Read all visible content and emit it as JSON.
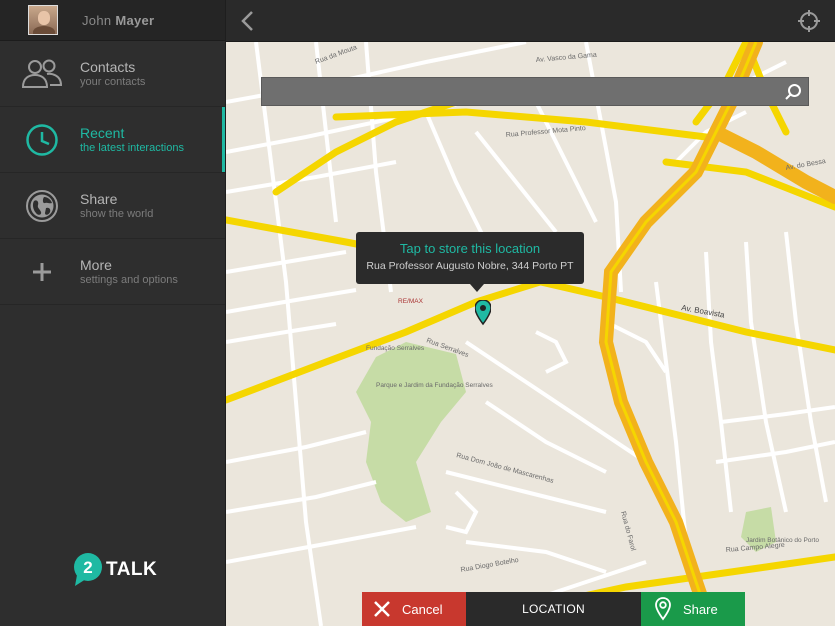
{
  "profile": {
    "first_name": "John",
    "last_name": "Mayer"
  },
  "menu": [
    {
      "label": "Contacts",
      "sub": "your contacts",
      "icon": "users-icon",
      "active": false
    },
    {
      "label": "Recent",
      "sub": "the latest interactions",
      "icon": "clock-icon",
      "active": true
    },
    {
      "label": "Share",
      "sub": "show  the world",
      "icon": "globe-icon",
      "active": false
    },
    {
      "label": "More",
      "sub": "settings and options",
      "icon": "plus-icon",
      "active": false
    }
  ],
  "logo": {
    "number": "2",
    "text": "TALK"
  },
  "search": {
    "value": "",
    "placeholder": ""
  },
  "tooltip": {
    "title": "Tap to store this location",
    "address": "Rua Professor Augusto Nobre, 344 Porto PT"
  },
  "bottom": {
    "cancel_label": "Cancel",
    "title": "LOCATION",
    "share_label": "Share"
  },
  "map_labels": [
    "Av. Vasco da Gama",
    "Rua da Mouta",
    "Rua Professor Mota Pinto",
    "Av. do Bessa",
    "Av. Boavista",
    "Rua Serralves",
    "Rua Diogo Botelho",
    "Rua Campo Alegre",
    "Parque e Jardim da Fundação Serralves",
    "Fundação Serralves",
    "RE/MAX",
    "Jardim Botânico do Porto",
    "Rua Dom João de Mascarenhas",
    "Rua do Farol"
  ],
  "colors": {
    "accent": "#1fb9a3",
    "cancel": "#c8382e",
    "share": "#1a9a4a",
    "map_bg": "#ebe6dc",
    "road_major": "#f5d600",
    "road_highway": "#f2b21c",
    "park": "#c6dca6"
  }
}
